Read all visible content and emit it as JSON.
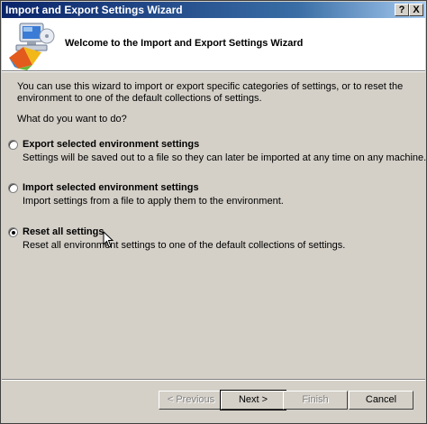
{
  "window": {
    "title": "Import and Export Settings Wizard",
    "help_label": "?",
    "close_label": "X"
  },
  "header": {
    "title": "Welcome to the Import and Export Settings Wizard",
    "logo_icon": "visual-studio-computer-icon"
  },
  "intro": "You can use this wizard to import or export specific categories of settings, or to reset the environment to one of the default collections of settings.",
  "question": "What do you want to do?",
  "options": [
    {
      "label": "Export selected environment settings",
      "description": "Settings will be saved out to a file so they can later be imported at any time on any machine.",
      "selected": false
    },
    {
      "label": "Import selected environment settings",
      "description": "Import settings from a file to apply them to the environment.",
      "selected": false
    },
    {
      "label": "Reset all settings",
      "description": "Reset all environment settings to one of the default collections of settings.",
      "selected": true
    }
  ],
  "buttons": {
    "previous": "< Previous",
    "next": "Next >",
    "finish": "Finish",
    "cancel": "Cancel"
  }
}
